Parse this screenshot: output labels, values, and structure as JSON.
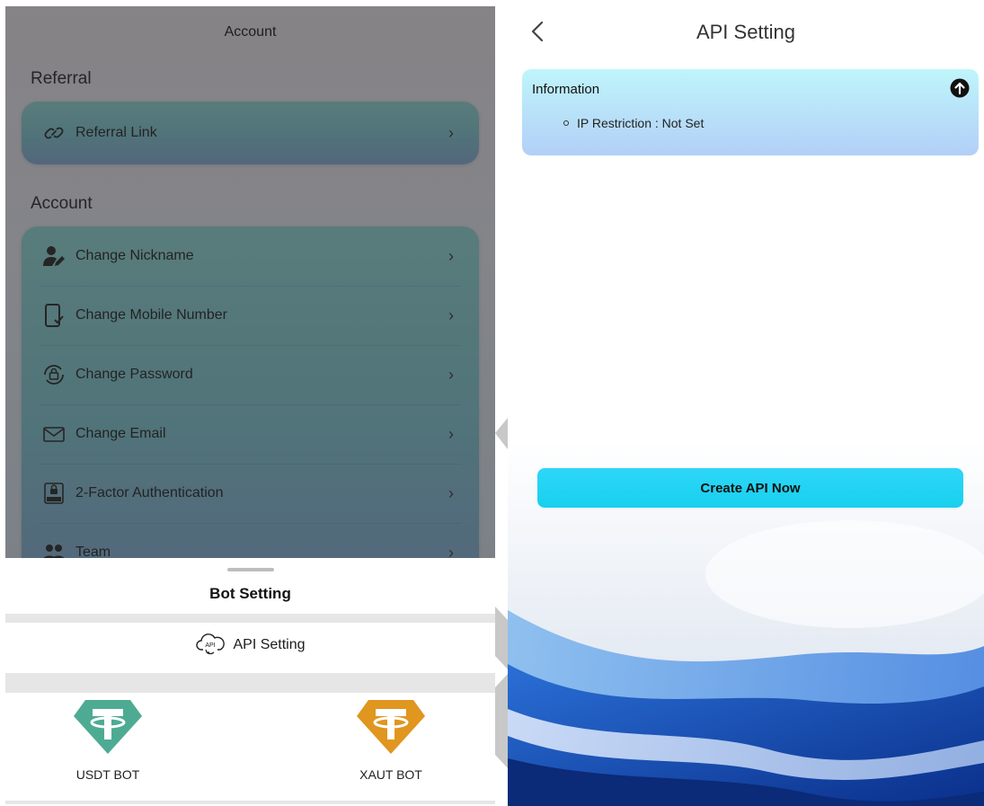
{
  "left": {
    "account_screen": {
      "title": "Account",
      "referral_section": "Referral",
      "referral_items": [
        {
          "label": "Referral Link",
          "icon": "link-icon"
        }
      ],
      "account_section": "Account",
      "account_items": [
        {
          "label": "Change Nickname",
          "icon": "user-edit-icon"
        },
        {
          "label": "Change Mobile Number",
          "icon": "mobile-check-icon"
        },
        {
          "label": "Change Password",
          "icon": "lock-refresh-icon"
        },
        {
          "label": "Change Email",
          "icon": "envelope-icon"
        },
        {
          "label": "2-Factor Authentication",
          "icon": "two-factor-icon"
        },
        {
          "label": "Team",
          "icon": "team-icon"
        }
      ],
      "chevron": "›"
    },
    "bottom_sheet": {
      "title": "Bot Setting",
      "api_setting_label": "API Setting",
      "api_setting_icon": "cloud-api-icon",
      "api_icon_text": "API",
      "bots": [
        {
          "label": "USDT BOT",
          "color": "#4eab93"
        },
        {
          "label": "XAUT BOT",
          "color": "#e0961f"
        }
      ]
    }
  },
  "right": {
    "page_title": "API Setting",
    "back_icon": "chevron-left-icon",
    "info": {
      "title": "Information",
      "toggle_icon": "arrow-up-circle-icon",
      "items": [
        {
          "text": "IP Restriction : Not Set"
        }
      ]
    },
    "create_button_label": "Create API Now"
  },
  "colors": {
    "accent_cyan": "#18d0ef",
    "card_teal": "#8ed8d6",
    "usdt_green": "#4eab93",
    "xaut_gold": "#e0961f"
  }
}
